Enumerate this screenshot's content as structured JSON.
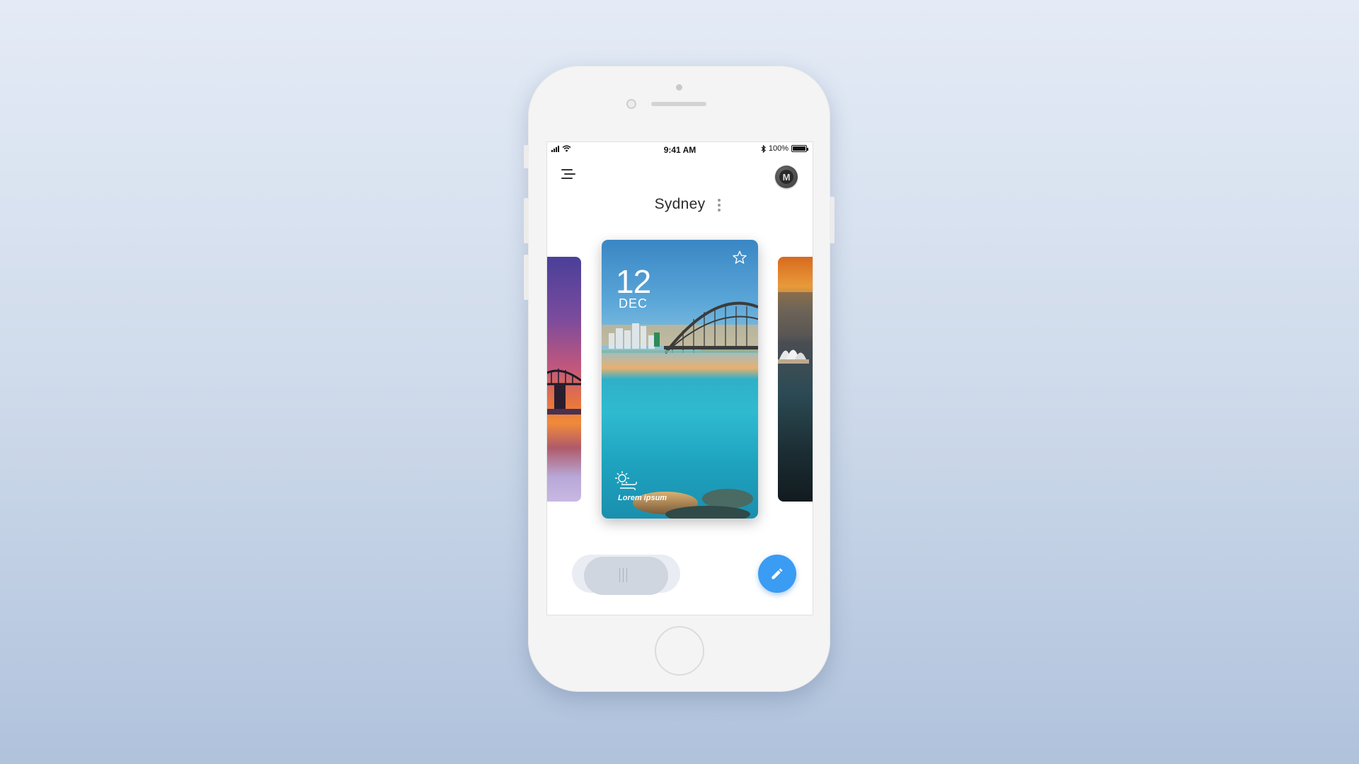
{
  "status_bar": {
    "time": "9:41 AM",
    "battery": "100%",
    "icons": [
      "signal-icon",
      "wifi-icon",
      "bluetooth-icon",
      "battery-icon"
    ]
  },
  "header": {
    "menu_icon": "menu-icon",
    "avatar_icon": "avatar-icon",
    "avatar_letter": "M",
    "city": "Sydney",
    "more_icon": "more-vertical-icon"
  },
  "card": {
    "day": "12",
    "month": "DEC",
    "caption": "Lorem ipsum",
    "favorite_icon": "star-icon",
    "weather_icon": "sun-wind-icon"
  },
  "controls": {
    "toggle_icon": "drag-handle-icon",
    "fab_icon": "pencil-icon"
  },
  "colors": {
    "accent": "#3a9cf3",
    "background_top": "#e4ebf6",
    "background_bottom": "#b0c2dc"
  }
}
